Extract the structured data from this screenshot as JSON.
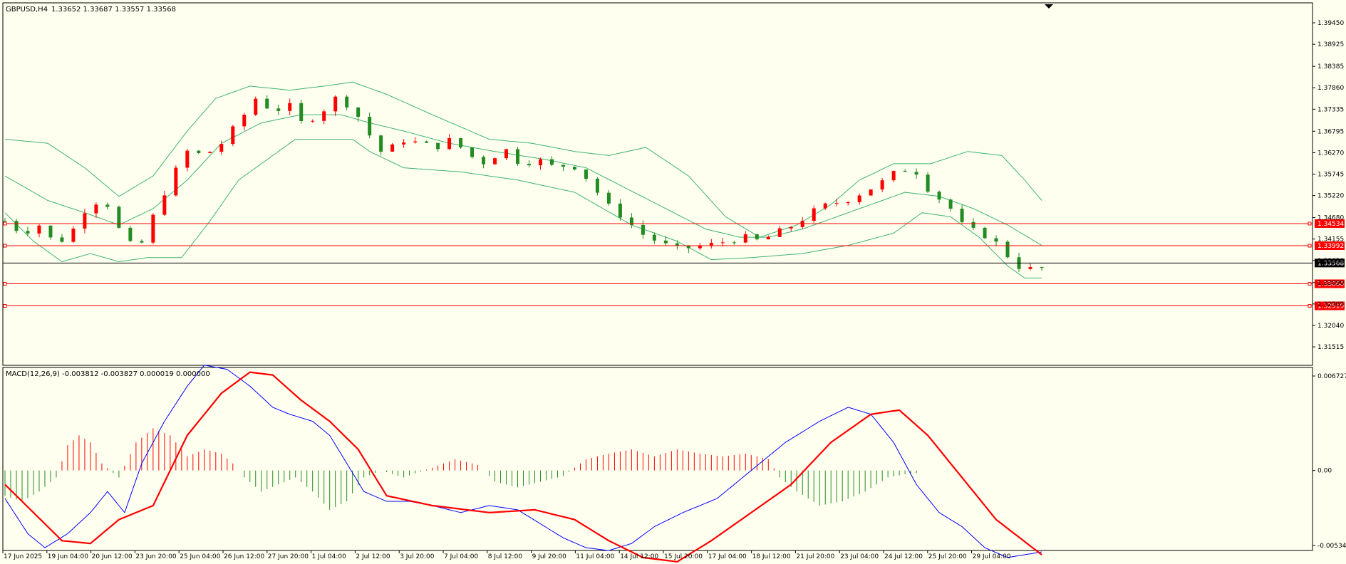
{
  "header": {
    "symbol": "GBPUSD,H4",
    "quote": "1.33652 1.33687 1.33557 1.33568"
  },
  "macd": {
    "label": "MACD(12,26,9) -0.003812 -0.003827 0.000019 0.000000",
    "scale": [
      {
        "label": "0.006727",
        "value": 0.006727
      },
      {
        "label": "0.00",
        "value": 0.0
      },
      {
        "label": "-0.005342",
        "value": -0.005342
      }
    ]
  },
  "colors": {
    "background": "#fffff0",
    "frame": "#000000",
    "bull_candle": "#ff0000",
    "bear_candle": "#228b22",
    "bands": "#3cb371",
    "hline": "#ff0000",
    "current_price_line": "#000000",
    "macd_main": "#0000ff",
    "macd_signal": "#ff0000",
    "hist_up": "#ff0000",
    "hist_down": "#228b22"
  },
  "chart_data": {
    "type": "candlestick",
    "price_axis": {
      "range": [
        1.3115,
        1.3973
      ],
      "ticks": [
        "1.39450",
        "1.38925",
        "1.38385",
        "1.37860",
        "1.37335",
        "1.36795",
        "1.36270",
        "1.35745",
        "1.35220",
        "1.34680",
        "1.34155",
        "1.33630",
        "1.33090",
        "1.32565",
        "1.32040",
        "1.31515"
      ]
    },
    "time_axis": {
      "labels": [
        "17 Jun 2025",
        "19 Jun 04:00",
        "20 Jun 12:00",
        "23 Jun 20:00",
        "25 Jun 04:00",
        "26 Jun 12:00",
        "27 Jun 20:00",
        "1 Jul 04:00",
        "2 Jul 12:00",
        "3 Jul 20:00",
        "7 Jul 04:00",
        "8 Jul 12:00",
        "9 Jul 20:00",
        "11 Jul 04:00",
        "14 Jul 12:00",
        "15 Jul 20:00",
        "17 Jul 04:00",
        "18 Jul 12:00",
        "21 Jul 20:00",
        "23 Jul 04:00",
        "24 Jul 12:00",
        "25 Jul 20:00",
        "29 Jul 04:00"
      ]
    },
    "price_levels": [
      {
        "label": "1.34534",
        "value": 1.34534
      },
      {
        "label": "1.33992",
        "value": 1.33992
      },
      {
        "label": "1.33060",
        "value": 1.3306
      },
      {
        "label": "1.32519",
        "value": 1.32519
      }
    ],
    "current_price": {
      "label": "1.33568",
      "value": 1.33568
    },
    "close_path": [
      [
        0,
        1.346
      ],
      [
        6,
        1.343
      ],
      [
        12,
        1.345
      ],
      [
        18,
        1.34
      ],
      [
        24,
        1.344
      ],
      [
        30,
        1.351
      ],
      [
        36,
        1.35
      ],
      [
        42,
        1.341
      ],
      [
        47,
        1.339
      ],
      [
        52,
        1.347
      ],
      [
        58,
        1.356
      ],
      [
        64,
        1.363
      ],
      [
        70,
        1.362
      ],
      [
        76,
        1.365
      ],
      [
        82,
        1.37
      ],
      [
        88,
        1.376
      ],
      [
        94,
        1.373
      ],
      [
        100,
        1.374
      ],
      [
        104,
        1.37
      ],
      [
        110,
        1.372
      ],
      [
        116,
        1.376
      ],
      [
        122,
        1.374
      ],
      [
        127,
        1.368
      ],
      [
        133,
        1.362
      ],
      [
        139,
        1.366
      ],
      [
        145,
        1.365
      ],
      [
        151,
        1.364
      ],
      [
        157,
        1.366
      ],
      [
        163,
        1.362
      ],
      [
        169,
        1.36
      ],
      [
        175,
        1.364
      ],
      [
        181,
        1.36
      ],
      [
        187,
        1.361
      ],
      [
        193,
        1.359
      ],
      [
        199,
        1.36
      ],
      [
        205,
        1.356
      ],
      [
        211,
        1.35
      ],
      [
        217,
        1.347
      ],
      [
        223,
        1.343
      ],
      [
        229,
        1.341
      ],
      [
        235,
        1.339
      ],
      [
        241,
        1.3395
      ],
      [
        247,
        1.34
      ],
      [
        253,
        1.341
      ],
      [
        259,
        1.342
      ],
      [
        265,
        1.341
      ],
      [
        271,
        1.343
      ],
      [
        277,
        1.345
      ],
      [
        283,
        1.348
      ],
      [
        289,
        1.35
      ],
      [
        295,
        1.351
      ],
      [
        301,
        1.353
      ],
      [
        307,
        1.355
      ],
      [
        313,
        1.358
      ],
      [
        319,
        1.359
      ],
      [
        325,
        1.353
      ],
      [
        331,
        1.35
      ],
      [
        337,
        1.344
      ],
      [
        343,
        1.343
      ],
      [
        349,
        1.34
      ],
      [
        355,
        1.335
      ],
      [
        361,
        1.334
      ],
      [
        364,
        1.3345
      ]
    ],
    "bands_upper": [
      [
        0,
        1.366
      ],
      [
        15,
        1.365
      ],
      [
        28,
        1.359
      ],
      [
        40,
        1.352
      ],
      [
        52,
        1.357
      ],
      [
        64,
        1.368
      ],
      [
        74,
        1.376
      ],
      [
        86,
        1.379
      ],
      [
        100,
        1.378
      ],
      [
        112,
        1.379
      ],
      [
        122,
        1.38
      ],
      [
        134,
        1.377
      ],
      [
        150,
        1.372
      ],
      [
        170,
        1.366
      ],
      [
        185,
        1.365
      ],
      [
        200,
        1.363
      ],
      [
        212,
        1.362
      ],
      [
        225,
        1.364
      ],
      [
        240,
        1.357
      ],
      [
        253,
        1.347
      ],
      [
        265,
        1.342
      ],
      [
        278,
        1.345
      ],
      [
        290,
        1.35
      ],
      [
        300,
        1.356
      ],
      [
        312,
        1.36
      ],
      [
        325,
        1.36
      ],
      [
        338,
        1.363
      ],
      [
        350,
        1.362
      ],
      [
        358,
        1.356
      ],
      [
        364,
        1.351
      ]
    ],
    "bands_middle": [
      [
        0,
        1.357
      ],
      [
        15,
        1.351
      ],
      [
        28,
        1.348
      ],
      [
        40,
        1.345
      ],
      [
        52,
        1.349
      ],
      [
        64,
        1.356
      ],
      [
        76,
        1.365
      ],
      [
        90,
        1.37
      ],
      [
        104,
        1.372
      ],
      [
        118,
        1.372
      ],
      [
        128,
        1.37
      ],
      [
        140,
        1.368
      ],
      [
        156,
        1.365
      ],
      [
        172,
        1.363
      ],
      [
        190,
        1.361
      ],
      [
        204,
        1.359
      ],
      [
        218,
        1.354
      ],
      [
        232,
        1.349
      ],
      [
        246,
        1.344
      ],
      [
        258,
        1.342
      ],
      [
        268,
        1.342
      ],
      [
        280,
        1.344
      ],
      [
        292,
        1.347
      ],
      [
        304,
        1.35
      ],
      [
        316,
        1.353
      ],
      [
        328,
        1.352
      ],
      [
        340,
        1.349
      ],
      [
        352,
        1.345
      ],
      [
        364,
        1.34
      ]
    ],
    "bands_lower": [
      [
        0,
        1.348
      ],
      [
        10,
        1.341
      ],
      [
        20,
        1.336
      ],
      [
        30,
        1.338
      ],
      [
        40,
        1.336
      ],
      [
        50,
        1.337
      ],
      [
        62,
        1.337
      ],
      [
        72,
        1.346
      ],
      [
        82,
        1.356
      ],
      [
        92,
        1.361
      ],
      [
        102,
        1.366
      ],
      [
        112,
        1.366
      ],
      [
        122,
        1.366
      ],
      [
        128,
        1.363
      ],
      [
        140,
        1.359
      ],
      [
        160,
        1.358
      ],
      [
        180,
        1.356
      ],
      [
        200,
        1.353
      ],
      [
        220,
        1.345
      ],
      [
        236,
        1.341
      ],
      [
        248,
        1.3365
      ],
      [
        262,
        1.337
      ],
      [
        280,
        1.338
      ],
      [
        296,
        1.34
      ],
      [
        312,
        1.343
      ],
      [
        322,
        1.348
      ],
      [
        332,
        1.347
      ],
      [
        342,
        1.342
      ],
      [
        352,
        1.335
      ],
      [
        358,
        1.332
      ],
      [
        364,
        1.332
      ]
    ],
    "macd_main_path": [
      [
        0,
        -0.002
      ],
      [
        8,
        -0.0045
      ],
      [
        14,
        -0.0055
      ],
      [
        22,
        -0.0045
      ],
      [
        30,
        -0.003
      ],
      [
        36,
        -0.0015
      ],
      [
        42,
        -0.003
      ],
      [
        48,
        0.0005
      ],
      [
        56,
        0.0035
      ],
      [
        64,
        0.006
      ],
      [
        70,
        0.0075
      ],
      [
        78,
        0.0072
      ],
      [
        86,
        0.006
      ],
      [
        94,
        0.0045
      ],
      [
        100,
        0.004
      ],
      [
        108,
        0.0035
      ],
      [
        114,
        0.0025
      ],
      [
        120,
        0.0005
      ],
      [
        126,
        -0.0015
      ],
      [
        134,
        -0.0022
      ],
      [
        142,
        -0.0022
      ],
      [
        150,
        -0.0025
      ],
      [
        160,
        -0.003
      ],
      [
        170,
        -0.0025
      ],
      [
        180,
        -0.0028
      ],
      [
        188,
        -0.0038
      ],
      [
        196,
        -0.0048
      ],
      [
        204,
        -0.0055
      ],
      [
        212,
        -0.0057
      ],
      [
        220,
        -0.0052
      ],
      [
        228,
        -0.004
      ],
      [
        238,
        -0.003
      ],
      [
        250,
        -0.002
      ],
      [
        262,
        0.0
      ],
      [
        274,
        0.002
      ],
      [
        286,
        0.0035
      ],
      [
        296,
        0.0045
      ],
      [
        304,
        0.004
      ],
      [
        312,
        0.002
      ],
      [
        320,
        -0.001
      ],
      [
        328,
        -0.003
      ],
      [
        336,
        -0.004
      ],
      [
        344,
        -0.0055
      ],
      [
        352,
        -0.0062
      ],
      [
        358,
        -0.006
      ],
      [
        364,
        -0.0058
      ]
    ],
    "macd_signal_path": [
      [
        0,
        -0.001
      ],
      [
        10,
        -0.003
      ],
      [
        20,
        -0.005
      ],
      [
        30,
        -0.0052
      ],
      [
        40,
        -0.0035
      ],
      [
        52,
        -0.0025
      ],
      [
        64,
        0.0025
      ],
      [
        76,
        0.0055
      ],
      [
        86,
        0.007
      ],
      [
        94,
        0.0068
      ],
      [
        104,
        0.005
      ],
      [
        114,
        0.0035
      ],
      [
        124,
        0.0015
      ],
      [
        134,
        -0.0018
      ],
      [
        150,
        -0.0025
      ],
      [
        170,
        -0.003
      ],
      [
        186,
        -0.0028
      ],
      [
        200,
        -0.0035
      ],
      [
        212,
        -0.005
      ],
      [
        224,
        -0.0062
      ],
      [
        236,
        -0.0065
      ],
      [
        248,
        -0.005
      ],
      [
        262,
        -0.003
      ],
      [
        276,
        -0.001
      ],
      [
        290,
        0.002
      ],
      [
        304,
        0.004
      ],
      [
        314,
        0.0043
      ],
      [
        324,
        0.0025
      ],
      [
        336,
        -0.0005
      ],
      [
        348,
        -0.0035
      ],
      [
        364,
        -0.006
      ]
    ],
    "macd_hist_path": [
      [
        0,
        -0.0018
      ],
      [
        6,
        -0.0022
      ],
      [
        12,
        -0.0015
      ],
      [
        18,
        -0.0005
      ],
      [
        22,
        0.0018
      ],
      [
        26,
        0.0025
      ],
      [
        30,
        0.002
      ],
      [
        34,
        0.0005
      ],
      [
        40,
        -0.0005
      ],
      [
        46,
        0.002
      ],
      [
        52,
        0.003
      ],
      [
        58,
        0.0025
      ],
      [
        64,
        0.001
      ],
      [
        70,
        0.0015
      ],
      [
        76,
        0.0012
      ],
      [
        80,
        0.0005
      ],
      [
        84,
        -0.0005
      ],
      [
        90,
        -0.0015
      ],
      [
        96,
        -0.001
      ],
      [
        102,
        -0.0005
      ],
      [
        108,
        -0.0015
      ],
      [
        114,
        -0.0028
      ],
      [
        120,
        -0.0022
      ],
      [
        126,
        -0.0005
      ],
      [
        132,
        0.0
      ],
      [
        140,
        -0.0005
      ],
      [
        150,
        0.0002
      ],
      [
        158,
        0.0008
      ],
      [
        166,
        0.0004
      ],
      [
        172,
        -0.0008
      ],
      [
        180,
        -0.0012
      ],
      [
        188,
        -0.0008
      ],
      [
        196,
        -0.0004
      ],
      [
        204,
        0.0008
      ],
      [
        212,
        0.0012
      ],
      [
        220,
        0.0015
      ],
      [
        228,
        0.001
      ],
      [
        236,
        0.0015
      ],
      [
        244,
        0.0012
      ],
      [
        252,
        0.001
      ],
      [
        260,
        0.0012
      ],
      [
        268,
        0.0008
      ],
      [
        272,
        -0.0005
      ],
      [
        278,
        -0.0015
      ],
      [
        286,
        -0.0025
      ],
      [
        294,
        -0.0022
      ],
      [
        302,
        -0.0015
      ],
      [
        310,
        -0.0005
      ],
      [
        318,
        -0.0002
      ]
    ]
  }
}
